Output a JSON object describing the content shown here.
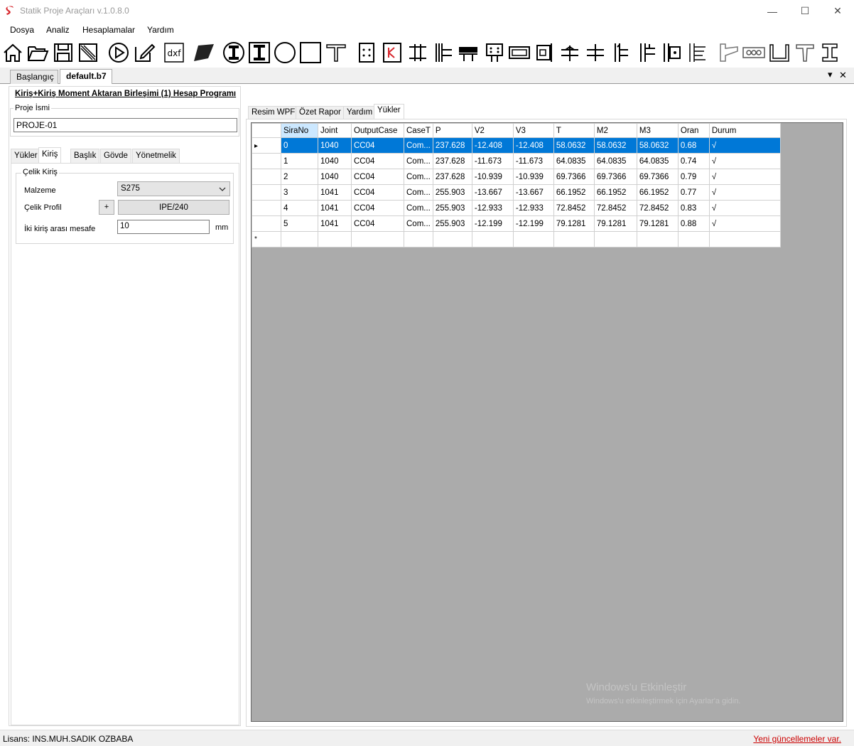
{
  "window": {
    "title": "Statik Proje Araçları v.1.0.8.0",
    "minimize": "—",
    "maximize": "☐",
    "close": "✕"
  },
  "menu": [
    "Dosya",
    "Analiz",
    "Hesaplamalar",
    "Yardım"
  ],
  "toolbar_icons": [
    "home-icon",
    "open-folder-icon",
    "save-icon",
    "print-icon",
    "play-icon",
    "edit-icon",
    "dxf-icon",
    "cut-icon",
    "i-beam-circle-icon",
    "i-beam-square-icon",
    "circle-section-icon",
    "square-section-icon",
    "t-section-icon",
    "plate-icon",
    "k-brace-icon",
    "column-base-icon",
    "beam-column-icon",
    "beam-splice-icon",
    "bolt-plate-icon",
    "flange-plate-icon",
    "end-plate-icon",
    "connection-1-icon",
    "connection-2-icon",
    "connection-3-icon",
    "connection-4-icon",
    "connection-5-icon",
    "connection-6-icon",
    "haunch-icon",
    "bolts-row-icon",
    "channel-icon",
    "tee-icon",
    "rail-icon"
  ],
  "toolbar_labels": {
    "dxf": "dxf"
  },
  "doc_tabs": {
    "start": "Başlangıç",
    "file": "default.b7",
    "dropdown": "▾",
    "close": "✕"
  },
  "form": {
    "title": "Kiriş+Kiriş Moment Aktaran Birleşimi (1) Hesap Programı",
    "project_name_label": "Proje İsmi",
    "project_name_value": "PROJE-01",
    "subtabs": [
      "Yükler",
      "Kiriş",
      "Başlık",
      "Gövde",
      "Yönetmelik"
    ],
    "group_label": "Çelik Kiriş",
    "material_label": "Malzeme",
    "material_value": "S275",
    "profile_label": "Çelik Profil",
    "profile_add": "+",
    "profile_value": "IPE/240",
    "distance_label": "İki kiriş arası mesafe",
    "distance_value": "10",
    "distance_unit": "mm"
  },
  "right_tabs": [
    "Resim WPF",
    "Özet Rapor",
    "Yardım",
    "Yükler"
  ],
  "grid": {
    "columns": [
      "SiraNo",
      "Joint",
      "OutputCase",
      "CaseT",
      "P",
      "V2",
      "V3",
      "T",
      "M2",
      "M3",
      "Oran",
      "Durum"
    ],
    "rows": [
      [
        "0",
        "1040",
        "CC04",
        "Com...",
        "237.628",
        "-12.408",
        "-12.408",
        "58.0632",
        "58.0632",
        "58.0632",
        "0.68",
        "√"
      ],
      [
        "1",
        "1040",
        "CC04",
        "Com...",
        "237.628",
        "-11.673",
        "-11.673",
        "64.0835",
        "64.0835",
        "64.0835",
        "0.74",
        "√"
      ],
      [
        "2",
        "1040",
        "CC04",
        "Com...",
        "237.628",
        "-10.939",
        "-10.939",
        "69.7366",
        "69.7366",
        "69.7366",
        "0.79",
        "√"
      ],
      [
        "3",
        "1041",
        "CC04",
        "Com...",
        "255.903",
        "-13.667",
        "-13.667",
        "66.1952",
        "66.1952",
        "66.1952",
        "0.77",
        "√"
      ],
      [
        "4",
        "1041",
        "CC04",
        "Com...",
        "255.903",
        "-12.933",
        "-12.933",
        "72.8452",
        "72.8452",
        "72.8452",
        "0.83",
        "√"
      ],
      [
        "5",
        "1041",
        "CC04",
        "Com...",
        "255.903",
        "-12.199",
        "-12.199",
        "79.1281",
        "79.1281",
        "79.1281",
        "0.88",
        "√"
      ]
    ],
    "selected_row_marker": "▸",
    "new_row_marker": "*"
  },
  "status": {
    "license": "Lisans: INS.MUH.SADIK OZBABA",
    "update": "Yeni güncellemeler var."
  },
  "watermark": {
    "line1": "Windows'u Etkinleştir",
    "line2": "Windows'u etkinleştirmek için Ayarlar'a gidin."
  },
  "colors": {
    "selection": "#0078d7",
    "grid_bg": "#ababab",
    "update_link": "#c00000",
    "brand_red": "#d7262c"
  }
}
